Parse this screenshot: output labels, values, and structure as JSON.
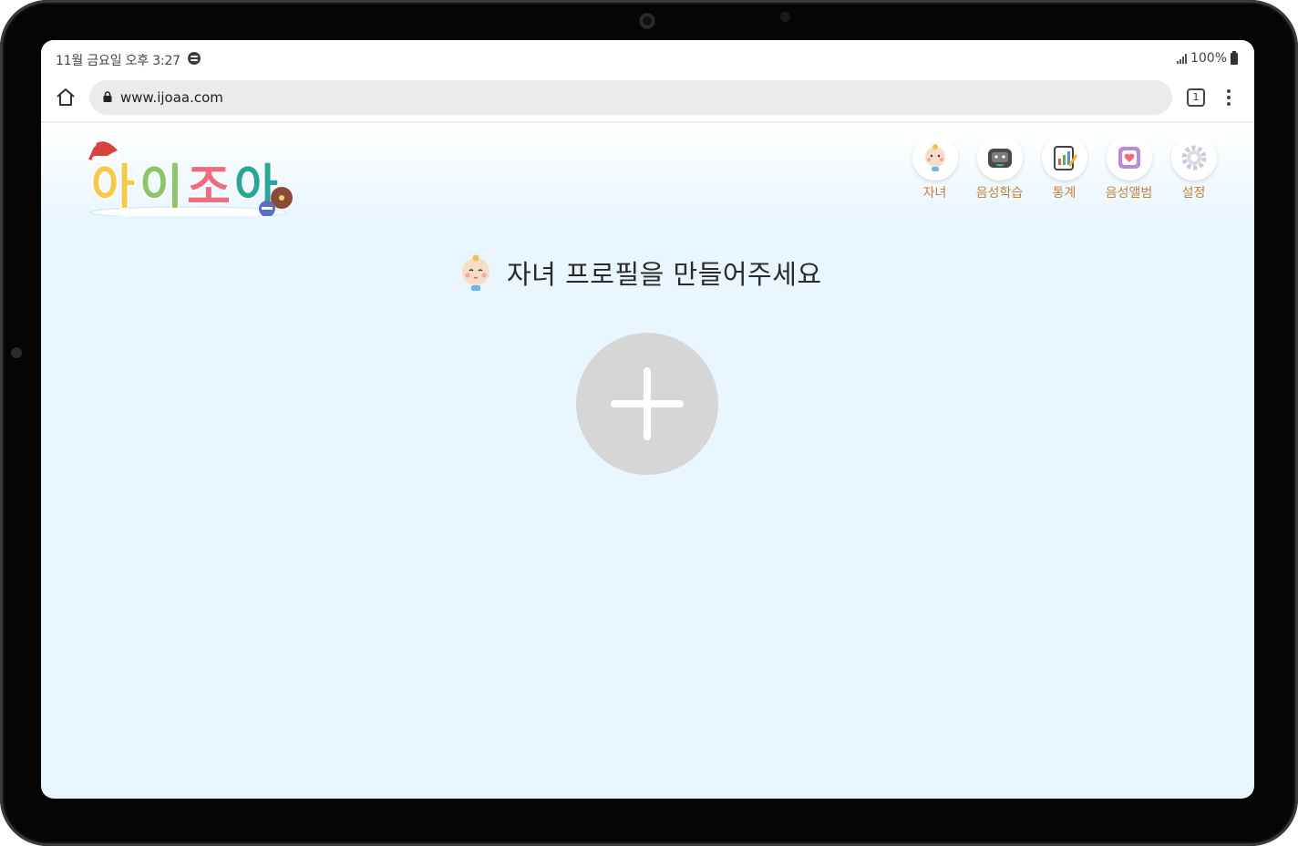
{
  "status_bar": {
    "time": "11월 금요일 오후 3:27",
    "battery": "100%"
  },
  "browser": {
    "url": "www.ijoaa.com",
    "tab_count": "1"
  },
  "app": {
    "logo_text": "아이조아",
    "nav": [
      {
        "label": "자녀",
        "icon": "baby-face-icon"
      },
      {
        "label": "음성학습",
        "icon": "robot-icon"
      },
      {
        "label": "통계",
        "icon": "stats-board-icon"
      },
      {
        "label": "음성앨범",
        "icon": "album-icon"
      },
      {
        "label": "설정",
        "icon": "gear-icon"
      }
    ],
    "prompt": "자녀 프로필을 만들어주세요",
    "add_button_icon": "plus-icon"
  },
  "colors": {
    "page_bg": "#eaf6ff",
    "nav_label": "#c0843f",
    "add_button": "#d6d6d6",
    "logo_yellow": "#f7c948",
    "logo_green": "#8cc56e",
    "logo_pink": "#ef6b7e",
    "logo_teal": "#2aa698"
  }
}
